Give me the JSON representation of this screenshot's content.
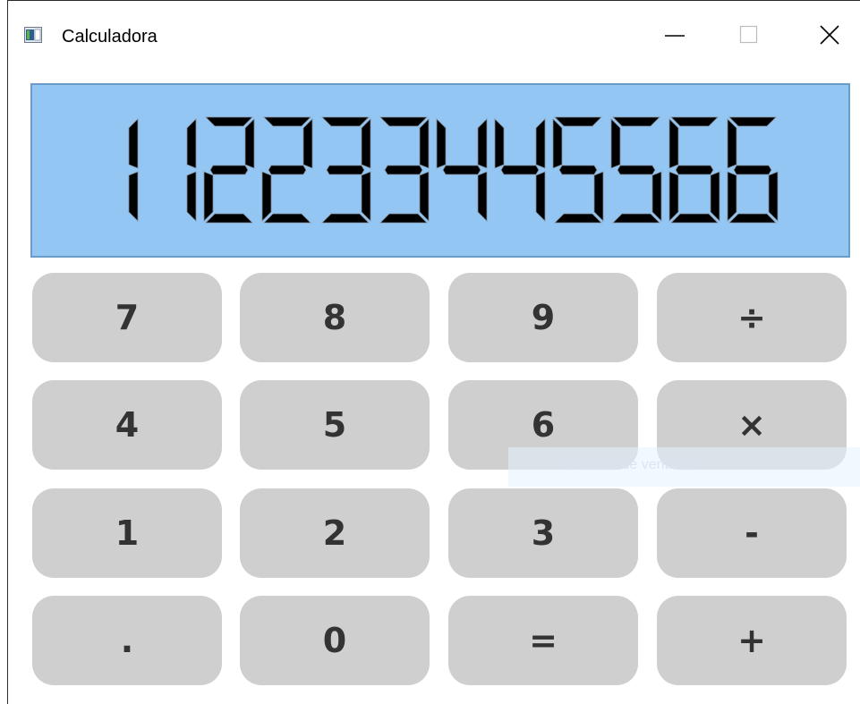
{
  "window": {
    "title": "Calculadora",
    "app_icon": "calculator-window-icon",
    "controls": [
      {
        "name": "minimize-button",
        "icon": "minimize-icon"
      },
      {
        "name": "maximize-button",
        "icon": "maximize-icon",
        "state": "disabled"
      },
      {
        "name": "close-button",
        "icon": "close-icon"
      }
    ]
  },
  "display": {
    "value": "1 1223344556 6",
    "digits": [
      "1",
      "1",
      "2",
      "2",
      "3",
      "3",
      "4",
      "4",
      "5",
      "5",
      "6",
      "6"
    ],
    "background": "#94c6f4",
    "digit_color": "#000000"
  },
  "keypad": {
    "rows": [
      [
        {
          "label": "7",
          "name": "key-7"
        },
        {
          "label": "8",
          "name": "key-8"
        },
        {
          "label": "9",
          "name": "key-9"
        },
        {
          "label": "÷",
          "name": "key-divide"
        }
      ],
      [
        {
          "label": "4",
          "name": "key-4"
        },
        {
          "label": "5",
          "name": "key-5"
        },
        {
          "label": "6",
          "name": "key-6"
        },
        {
          "label": "×",
          "name": "key-multiply"
        }
      ],
      [
        {
          "label": "1",
          "name": "key-1"
        },
        {
          "label": "2",
          "name": "key-2"
        },
        {
          "label": "3",
          "name": "key-3"
        },
        {
          "label": "-",
          "name": "key-subtract"
        }
      ],
      [
        {
          "label": ".",
          "name": "key-decimal"
        },
        {
          "label": "0",
          "name": "key-0"
        },
        {
          "label": "=",
          "name": "key-equals"
        },
        {
          "label": "+",
          "name": "key-add"
        }
      ]
    ],
    "button_color": "#cfcfcf",
    "text_color": "#333333"
  },
  "overlay": {
    "snip_label": "Recorte de ventana"
  }
}
